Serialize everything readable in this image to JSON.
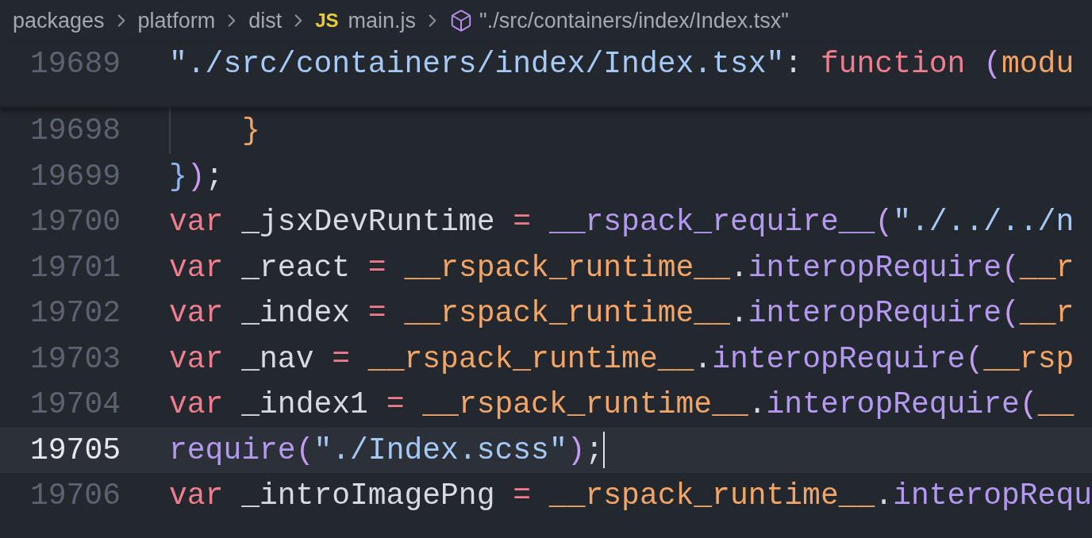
{
  "breadcrumb": [
    {
      "kind": "folder",
      "label": "packages"
    },
    {
      "kind": "folder",
      "label": "platform"
    },
    {
      "kind": "folder",
      "label": "dist"
    },
    {
      "kind": "js",
      "badge": "JS",
      "label": "main.js"
    },
    {
      "kind": "symbol",
      "label": "\"./src/containers/index/Index.tsx\""
    }
  ],
  "sticky_line": {
    "number": "19689",
    "tokens": [
      {
        "color": "#a5c8f5",
        "t": "\"./src/containers/index/Index.tsx\""
      },
      {
        "color": "#d7dae0",
        "t": ":"
      },
      {
        "color": "#ef7d8e",
        "t": " function"
      },
      {
        "color": "#c39cf2",
        "t": " ("
      },
      {
        "color": "#f2a566",
        "t": "modu"
      }
    ]
  },
  "lines": [
    {
      "number": "19698",
      "current": false,
      "indented": true,
      "tokens": [
        {
          "color": "#f2a566",
          "t": "}"
        }
      ]
    },
    {
      "number": "19699",
      "current": false,
      "indented": false,
      "tokens": [
        {
          "color": "#8fb4f0",
          "t": "}"
        },
        {
          "color": "#c39cf2",
          "t": ")"
        },
        {
          "color": "#d7dae0",
          "t": ";"
        }
      ]
    },
    {
      "number": "19700",
      "current": false,
      "indented": false,
      "tokens": [
        {
          "color": "#ef7d8e",
          "t": "var"
        },
        {
          "color": "#d7dae0",
          "t": " _jsxDevRuntime"
        },
        {
          "color": "#ef7d8e",
          "t": " ="
        },
        {
          "color": "#b39af0",
          "t": " __rspack_require__"
        },
        {
          "color": "#c39cf2",
          "t": "("
        },
        {
          "color": "#a5c8f5",
          "t": "\"./../../n"
        }
      ]
    },
    {
      "number": "19701",
      "current": false,
      "indented": false,
      "tokens": [
        {
          "color": "#ef7d8e",
          "t": "var"
        },
        {
          "color": "#d7dae0",
          "t": " _react"
        },
        {
          "color": "#ef7d8e",
          "t": " ="
        },
        {
          "color": "#f2a566",
          "t": " __rspack_runtime__"
        },
        {
          "color": "#d7dae0",
          "t": "."
        },
        {
          "color": "#b39af0",
          "t": "interopRequire"
        },
        {
          "color": "#c39cf2",
          "t": "("
        },
        {
          "color": "#f2a566",
          "t": "__r"
        }
      ]
    },
    {
      "number": "19702",
      "current": false,
      "indented": false,
      "tokens": [
        {
          "color": "#ef7d8e",
          "t": "var"
        },
        {
          "color": "#d7dae0",
          "t": " _index"
        },
        {
          "color": "#ef7d8e",
          "t": " ="
        },
        {
          "color": "#f2a566",
          "t": " __rspack_runtime__"
        },
        {
          "color": "#d7dae0",
          "t": "."
        },
        {
          "color": "#b39af0",
          "t": "interopRequire"
        },
        {
          "color": "#c39cf2",
          "t": "("
        },
        {
          "color": "#f2a566",
          "t": "__r"
        }
      ]
    },
    {
      "number": "19703",
      "current": false,
      "indented": false,
      "tokens": [
        {
          "color": "#ef7d8e",
          "t": "var"
        },
        {
          "color": "#d7dae0",
          "t": " _nav"
        },
        {
          "color": "#ef7d8e",
          "t": " ="
        },
        {
          "color": "#f2a566",
          "t": " __rspack_runtime__"
        },
        {
          "color": "#d7dae0",
          "t": "."
        },
        {
          "color": "#b39af0",
          "t": "interopRequire"
        },
        {
          "color": "#c39cf2",
          "t": "("
        },
        {
          "color": "#f2a566",
          "t": "__rsp"
        }
      ]
    },
    {
      "number": "19704",
      "current": false,
      "indented": false,
      "tokens": [
        {
          "color": "#ef7d8e",
          "t": "var"
        },
        {
          "color": "#d7dae0",
          "t": " _index1"
        },
        {
          "color": "#ef7d8e",
          "t": " ="
        },
        {
          "color": "#f2a566",
          "t": " __rspack_runtime__"
        },
        {
          "color": "#d7dae0",
          "t": "."
        },
        {
          "color": "#b39af0",
          "t": "interopRequire"
        },
        {
          "color": "#c39cf2",
          "t": "("
        },
        {
          "color": "#f2a566",
          "t": "__"
        }
      ]
    },
    {
      "number": "19705",
      "current": true,
      "indented": false,
      "tokens": [
        {
          "color": "#b39af0",
          "t": "require"
        },
        {
          "color": "#c39cf2",
          "t": "("
        },
        {
          "color": "#a5c8f5",
          "t": "\"./Index.scss\""
        },
        {
          "color": "#c39cf2",
          "t": ")"
        },
        {
          "color": "#d7dae0",
          "t": ";"
        }
      ]
    },
    {
      "number": "19706",
      "current": false,
      "indented": false,
      "tokens": [
        {
          "color": "#ef7d8e",
          "t": "var"
        },
        {
          "color": "#d7dae0",
          "t": " _introImagePng"
        },
        {
          "color": "#ef7d8e",
          "t": " ="
        },
        {
          "color": "#f2a566",
          "t": " __rspack_runtime__"
        },
        {
          "color": "#d7dae0",
          "t": "."
        },
        {
          "color": "#b39af0",
          "t": "interopRequ"
        }
      ]
    }
  ]
}
